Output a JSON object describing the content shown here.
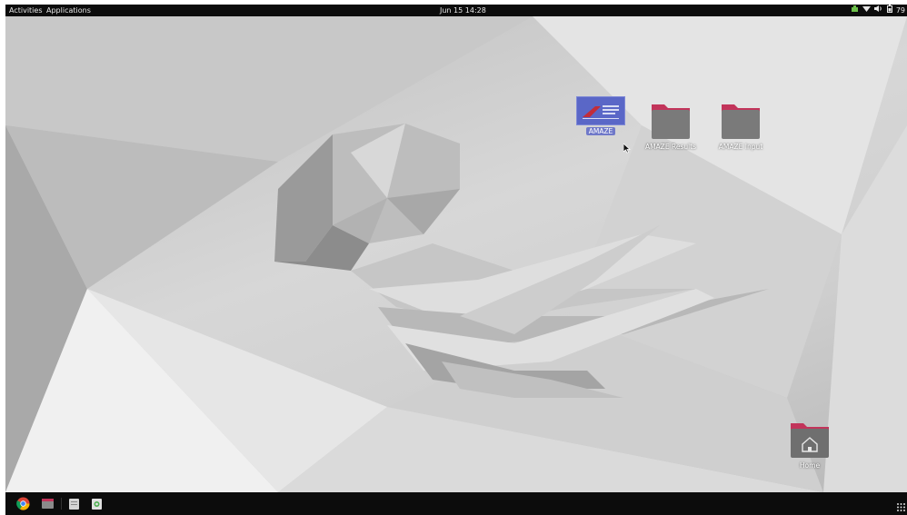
{
  "topbar": {
    "activities": "Activities",
    "applications": "Applications",
    "clock": "Jun 15  14:28",
    "battery": "79",
    "tray_icons": [
      "app-indicator-icon",
      "wifi-icon",
      "volume-icon",
      "battery-icon"
    ]
  },
  "desktop": {
    "icons": [
      {
        "label": "AMAZE",
        "icon": "amaze-shortcut-icon",
        "selected": true
      },
      {
        "label": "AMAZE Results",
        "icon": "folder-icon"
      },
      {
        "label": "AMAZE Input",
        "icon": "folder-icon"
      },
      {
        "label": "Home",
        "icon": "home-folder-icon"
      }
    ]
  },
  "dock": {
    "apps": [
      "chrome-icon",
      "files-icon",
      "text-editor-icon",
      "trash-icon"
    ],
    "app_grid": "show-applications-icon"
  },
  "colors": {
    "panel": "#0c0c0c",
    "selection": "#7079c9",
    "folder_tab": "#c2345a",
    "folder_body": "#7a7a7a"
  }
}
